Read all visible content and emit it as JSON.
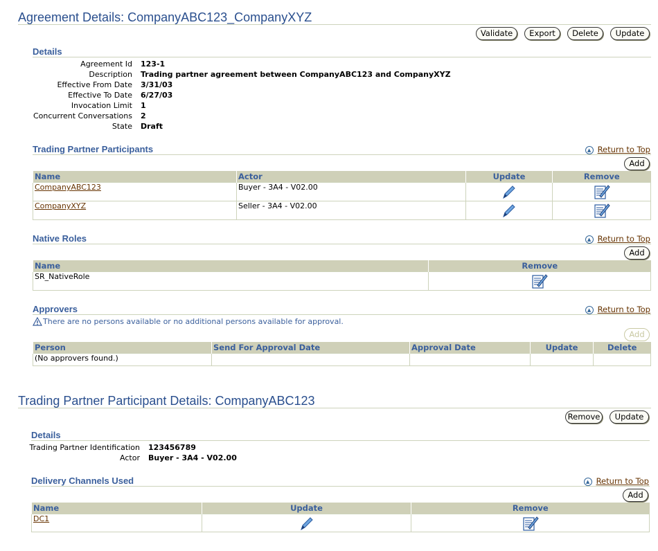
{
  "agreement": {
    "title": "Agreement Details: CompanyABC123_CompanyXYZ",
    "buttons": {
      "validate": "Validate",
      "export": "Export",
      "delete": "Delete",
      "update": "Update"
    },
    "details": {
      "heading": "Details",
      "fields": [
        {
          "label": "Agreement Id",
          "value": "123-1"
        },
        {
          "label": "Description",
          "value": "Trading partner agreement between CompanyABC123 and CompanyXYZ"
        },
        {
          "label": "Effective From Date",
          "value": "3/31/03"
        },
        {
          "label": "Effective To Date",
          "value": "6/27/03"
        },
        {
          "label": "Invocation Limit",
          "value": "1"
        },
        {
          "label": "Concurrent Conversations",
          "value": "2"
        },
        {
          "label": "State",
          "value": "Draft"
        }
      ]
    },
    "participants": {
      "heading": "Trading Partner Participants",
      "return_to_top": "Return to Top",
      "add_label": "Add",
      "columns": {
        "name": "Name",
        "actor": "Actor",
        "update": "Update",
        "remove": "Remove"
      },
      "rows": [
        {
          "name": "CompanyABC123",
          "actor": "Buyer - 3A4 - V02.00"
        },
        {
          "name": "CompanyXYZ",
          "actor": "Seller - 3A4 - V02.00"
        }
      ]
    },
    "native_roles": {
      "heading": "Native Roles",
      "return_to_top": "Return to Top",
      "add_label": "Add",
      "columns": {
        "name": "Name",
        "remove": "Remove"
      },
      "rows": [
        {
          "name": "SR_NativeRole"
        }
      ]
    },
    "approvers": {
      "heading": "Approvers",
      "return_to_top": "Return to Top",
      "warning": "There are no persons available or no additional persons available for approval.",
      "add_label": "Add",
      "columns": {
        "person": "Person",
        "send_date": "Send For Approval Date",
        "approval_date": "Approval Date",
        "update": "Update",
        "delete": "Delete"
      },
      "empty": "(No approvers found.)"
    }
  },
  "participant_details": {
    "title": "Trading Partner Participant Details: CompanyABC123",
    "buttons": {
      "remove": "Remove",
      "update": "Update"
    },
    "details": {
      "heading": "Details",
      "fields": [
        {
          "label": "Trading Partner Identification",
          "value": "123456789"
        },
        {
          "label": "Actor",
          "value": "Buyer - 3A4 - V02.00"
        }
      ]
    },
    "channels": {
      "heading": "Delivery Channels Used",
      "return_to_top": "Return to Top",
      "add_label": "Add",
      "columns": {
        "name": "Name",
        "update": "Update",
        "remove": "Remove"
      },
      "rows": [
        {
          "name": "DC1"
        }
      ]
    }
  },
  "icons": {
    "update": "pencil-icon",
    "remove": "remove-icon",
    "return": "return-to-top-icon",
    "warning": "warning-icon"
  },
  "colors": {
    "title": "#2a4f8e",
    "section": "#3a5f9c",
    "header_bg": "#cfd0b8",
    "link": "#663300",
    "rule": "#cdd3bb"
  }
}
